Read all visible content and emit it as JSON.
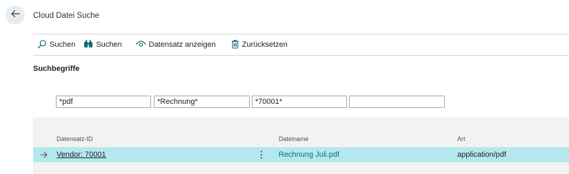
{
  "page": {
    "title": "Cloud Datei Suche"
  },
  "actions": [
    {
      "label": "Suchen",
      "icon": "search-icon"
    },
    {
      "label": "Suchen",
      "icon": "binoculars-icon"
    },
    {
      "label": "Datensatz anzeigen",
      "icon": "eye-icon"
    },
    {
      "label": "Zurücksetzen",
      "icon": "trash-icon"
    }
  ],
  "search": {
    "section_title": "Suchbegriffe",
    "terms": [
      "*pdf",
      "*Rechnung*",
      "*70001*",
      ""
    ]
  },
  "grid": {
    "columns": [
      "Datensatz-ID",
      "Dateiname",
      "Art"
    ],
    "rows": [
      {
        "record_id": "Vendor: 70001",
        "file_name": "Rechnung Juli.pdf",
        "type": "application/pdf",
        "selected": true
      }
    ]
  },
  "colors": {
    "accent": "#0f6a72",
    "selected_row": "#b3e8ee",
    "grid_background": "#f2f2f2",
    "back_button": "#e6eef4"
  }
}
